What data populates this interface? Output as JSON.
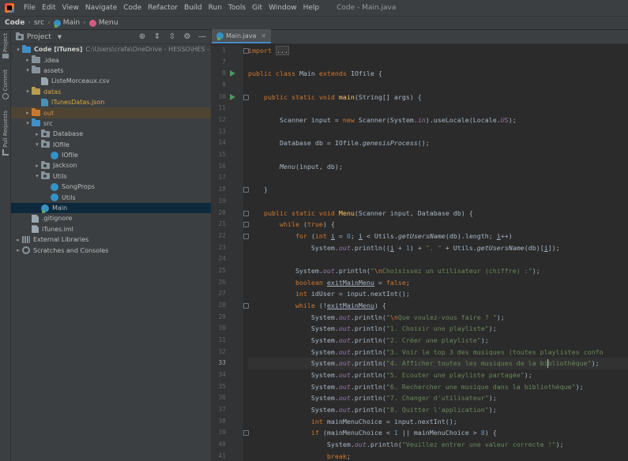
{
  "menubar": {
    "items": [
      "File",
      "Edit",
      "View",
      "Navigate",
      "Code",
      "Refactor",
      "Build",
      "Run",
      "Tools",
      "Git",
      "Window",
      "Help"
    ],
    "window_title": "Code - Main.java"
  },
  "breadcrumb": [
    "Code",
    "src",
    "Main",
    "Menu"
  ],
  "toolstrip": [
    "Project",
    "Commit",
    "Pull Requests"
  ],
  "project": {
    "title": "Project",
    "tree": [
      {
        "label": "Code [iTunes]",
        "path": "C:\\Users\\crafa\\OneDrive - HESSO\\HES - INFO G",
        "type": "folder-blue",
        "depth": 0,
        "arrow": "down"
      },
      {
        "label": ".idea",
        "type": "folder",
        "depth": 1,
        "arrow": "right"
      },
      {
        "label": "assets",
        "type": "folder",
        "depth": 1,
        "arrow": "down"
      },
      {
        "label": "ListeMorceaux.csv",
        "type": "file",
        "depth": 2,
        "arrow": "none"
      },
      {
        "label": "datas",
        "type": "folder-yellow",
        "depth": 1,
        "arrow": "down",
        "color": "yellow"
      },
      {
        "label": "iTunesDatas.json",
        "type": "file-json",
        "depth": 2,
        "arrow": "none",
        "color": "yellow"
      },
      {
        "label": "out",
        "type": "folder-orange",
        "depth": 1,
        "arrow": "right",
        "color": "orange",
        "excluded": true
      },
      {
        "label": "src",
        "type": "folder-blue",
        "depth": 1,
        "arrow": "down"
      },
      {
        "label": "Database",
        "type": "package",
        "depth": 2,
        "arrow": "right"
      },
      {
        "label": "IOfile",
        "type": "package",
        "depth": 2,
        "arrow": "down"
      },
      {
        "label": "IOfile",
        "type": "class",
        "depth": 3,
        "arrow": "none"
      },
      {
        "label": "Jackson",
        "type": "package",
        "depth": 2,
        "arrow": "right"
      },
      {
        "label": "Utils",
        "type": "package",
        "depth": 2,
        "arrow": "down"
      },
      {
        "label": "SongProps",
        "type": "class",
        "depth": 3,
        "arrow": "none"
      },
      {
        "label": "Utils",
        "type": "class",
        "depth": 3,
        "arrow": "none"
      },
      {
        "label": "Main",
        "type": "class-main",
        "depth": 2,
        "arrow": "none",
        "selected": true
      },
      {
        "label": ".gitignore",
        "type": "file",
        "depth": 1,
        "arrow": "none"
      },
      {
        "label": "iTunes.iml",
        "type": "file",
        "depth": 1,
        "arrow": "none"
      },
      {
        "label": "External Libraries",
        "type": "library",
        "depth": 0,
        "arrow": "right"
      },
      {
        "label": "Scratches and Consoles",
        "type": "scratch",
        "depth": 0,
        "arrow": "right"
      }
    ]
  },
  "editor": {
    "tab": "Main.java",
    "current_line": 33,
    "lines": [
      {
        "n": 1,
        "fold": true,
        "tokens": [
          {
            "t": "import ",
            "c": "kw"
          },
          {
            "t": "...",
            "c": "folded"
          }
        ]
      },
      {
        "n": 7,
        "tokens": []
      },
      {
        "n": 8,
        "run": true,
        "tokens": [
          {
            "t": "public class ",
            "c": "kw"
          },
          {
            "t": "Main ",
            "c": "plain"
          },
          {
            "t": "extends ",
            "c": "kw"
          },
          {
            "t": "IOfile {",
            "c": "plain"
          }
        ]
      },
      {
        "n": 9,
        "tokens": []
      },
      {
        "n": 10,
        "run": true,
        "fold": true,
        "tokens": [
          {
            "t": "    public static void ",
            "c": "kw"
          },
          {
            "t": "main",
            "c": "method"
          },
          {
            "t": "(String[] args) {",
            "c": "plain"
          }
        ]
      },
      {
        "n": 11,
        "tokens": []
      },
      {
        "n": 12,
        "tokens": [
          {
            "t": "        Scanner input = ",
            "c": "plain"
          },
          {
            "t": "new ",
            "c": "kw"
          },
          {
            "t": "Scanner(System.",
            "c": "plain"
          },
          {
            "t": "in",
            "c": "staticf"
          },
          {
            "t": ").useLocale(Locale.",
            "c": "plain"
          },
          {
            "t": "US",
            "c": "staticf"
          },
          {
            "t": ");",
            "c": "plain"
          }
        ]
      },
      {
        "n": 13,
        "tokens": []
      },
      {
        "n": 14,
        "tokens": [
          {
            "t": "        Database db = IOfile.",
            "c": "plain"
          },
          {
            "t": "genesisProcess",
            "c": "staticm"
          },
          {
            "t": "();",
            "c": "plain"
          }
        ]
      },
      {
        "n": 15,
        "tokens": []
      },
      {
        "n": 16,
        "tokens": [
          {
            "t": "        ",
            "c": "plain"
          },
          {
            "t": "Menu",
            "c": "staticm"
          },
          {
            "t": "(input, db);",
            "c": "plain"
          }
        ]
      },
      {
        "n": 17,
        "tokens": []
      },
      {
        "n": 18,
        "fold": true,
        "tokens": [
          {
            "t": "    }",
            "c": "plain"
          }
        ]
      },
      {
        "n": 19,
        "tokens": []
      },
      {
        "n": 20,
        "fold": true,
        "tokens": [
          {
            "t": "    public static void ",
            "c": "kw"
          },
          {
            "t": "Menu",
            "c": "method"
          },
          {
            "t": "(Scanner input, Database db) {",
            "c": "plain"
          }
        ]
      },
      {
        "n": 21,
        "fold": true,
        "tokens": [
          {
            "t": "        while ",
            "c": "kw"
          },
          {
            "t": "(",
            "c": "plain"
          },
          {
            "t": "true",
            "c": "kw"
          },
          {
            "t": ") {",
            "c": "plain"
          }
        ]
      },
      {
        "n": 22,
        "fold": true,
        "tokens": [
          {
            "t": "            for ",
            "c": "kw"
          },
          {
            "t": "(",
            "c": "plain"
          },
          {
            "t": "int ",
            "c": "kw"
          },
          {
            "t": "i",
            "c": "uvar"
          },
          {
            "t": " = ",
            "c": "plain"
          },
          {
            "t": "0",
            "c": "num"
          },
          {
            "t": "; ",
            "c": "plain"
          },
          {
            "t": "i",
            "c": "uvar"
          },
          {
            "t": " < Utils.",
            "c": "plain"
          },
          {
            "t": "getUsersName",
            "c": "staticm"
          },
          {
            "t": "(db).length; ",
            "c": "plain"
          },
          {
            "t": "i",
            "c": "uvar"
          },
          {
            "t": "++)",
            "c": "plain"
          }
        ]
      },
      {
        "n": 23,
        "tokens": [
          {
            "t": "                System.",
            "c": "plain"
          },
          {
            "t": "out",
            "c": "staticf"
          },
          {
            "t": ".println((",
            "c": "plain"
          },
          {
            "t": "i",
            "c": "uvar"
          },
          {
            "t": " + ",
            "c": "plain"
          },
          {
            "t": "1",
            "c": "num"
          },
          {
            "t": ") + ",
            "c": "plain"
          },
          {
            "t": "\". \"",
            "c": "str"
          },
          {
            "t": " + Utils.",
            "c": "plain"
          },
          {
            "t": "getUsersName",
            "c": "staticm"
          },
          {
            "t": "(db)[",
            "c": "plain"
          },
          {
            "t": "i",
            "c": "uvar"
          },
          {
            "t": "]);",
            "c": "plain"
          }
        ]
      },
      {
        "n": 24,
        "tokens": []
      },
      {
        "n": 25,
        "tokens": [
          {
            "t": "            System.",
            "c": "plain"
          },
          {
            "t": "out",
            "c": "staticf"
          },
          {
            "t": ".println(",
            "c": "plain"
          },
          {
            "t": "\"",
            "c": "str"
          },
          {
            "t": "\\n",
            "c": "esc"
          },
          {
            "t": "Choisissez un utilisateur (chiffre) :\"",
            "c": "str"
          },
          {
            "t": ");",
            "c": "plain"
          }
        ]
      },
      {
        "n": 26,
        "tokens": [
          {
            "t": "            boolean ",
            "c": "kw"
          },
          {
            "t": "exitMainMenu",
            "c": "uvar"
          },
          {
            "t": " = ",
            "c": "plain"
          },
          {
            "t": "false",
            "c": "kw"
          },
          {
            "t": ";",
            "c": "plain"
          }
        ]
      },
      {
        "n": 27,
        "tokens": [
          {
            "t": "            int ",
            "c": "kw"
          },
          {
            "t": "idUser = input.nextInt();",
            "c": "plain"
          }
        ]
      },
      {
        "n": 28,
        "fold": true,
        "tokens": [
          {
            "t": "            while ",
            "c": "kw"
          },
          {
            "t": "(!",
            "c": "plain"
          },
          {
            "t": "exitMainMenu",
            "c": "uvar"
          },
          {
            "t": ") {",
            "c": "plain"
          }
        ]
      },
      {
        "n": 29,
        "tokens": [
          {
            "t": "                System.",
            "c": "plain"
          },
          {
            "t": "out",
            "c": "staticf"
          },
          {
            "t": ".println(",
            "c": "plain"
          },
          {
            "t": "\"",
            "c": "str"
          },
          {
            "t": "\\n",
            "c": "esc"
          },
          {
            "t": "Que voulez-vous faire ? \"",
            "c": "str"
          },
          {
            "t": ");",
            "c": "plain"
          }
        ]
      },
      {
        "n": 30,
        "tokens": [
          {
            "t": "                System.",
            "c": "plain"
          },
          {
            "t": "out",
            "c": "staticf"
          },
          {
            "t": ".println(",
            "c": "plain"
          },
          {
            "t": "\"1. Choisir une playliste\"",
            "c": "str"
          },
          {
            "t": ");",
            "c": "plain"
          }
        ]
      },
      {
        "n": 31,
        "tokens": [
          {
            "t": "                System.",
            "c": "plain"
          },
          {
            "t": "out",
            "c": "staticf"
          },
          {
            "t": ".println(",
            "c": "plain"
          },
          {
            "t": "\"2. Créer une playliste\"",
            "c": "str"
          },
          {
            "t": ");",
            "c": "plain"
          }
        ]
      },
      {
        "n": 32,
        "tokens": [
          {
            "t": "                System.",
            "c": "plain"
          },
          {
            "t": "out",
            "c": "staticf"
          },
          {
            "t": ".println(",
            "c": "plain"
          },
          {
            "t": "\"3. Voir le top 3 des musiques (toutes playlistes confo",
            "c": "str"
          }
        ]
      },
      {
        "n": 33,
        "tokens": [
          {
            "t": "                System.",
            "c": "plain"
          },
          {
            "t": "out",
            "c": "staticf"
          },
          {
            "t": ".println(",
            "c": "plain"
          },
          {
            "t": "\"4. Afficher toutes les musiques de la bi",
            "c": "str"
          },
          {
            "t": "|",
            "c": "caret"
          },
          {
            "t": "bliothèque\"",
            "c": "str"
          },
          {
            "t": ");",
            "c": "plain"
          }
        ]
      },
      {
        "n": 34,
        "tokens": [
          {
            "t": "                System.",
            "c": "plain"
          },
          {
            "t": "out",
            "c": "staticf"
          },
          {
            "t": ".println(",
            "c": "plain"
          },
          {
            "t": "\"5. Ecouter une playliste partagée\"",
            "c": "str"
          },
          {
            "t": ");",
            "c": "plain"
          }
        ]
      },
      {
        "n": 35,
        "tokens": [
          {
            "t": "                System.",
            "c": "plain"
          },
          {
            "t": "out",
            "c": "staticf"
          },
          {
            "t": ".println(",
            "c": "plain"
          },
          {
            "t": "\"6. Rechercher une musique dans la bibliothèque\"",
            "c": "str"
          },
          {
            "t": ");",
            "c": "plain"
          }
        ]
      },
      {
        "n": 36,
        "tokens": [
          {
            "t": "                System.",
            "c": "plain"
          },
          {
            "t": "out",
            "c": "staticf"
          },
          {
            "t": ".println(",
            "c": "plain"
          },
          {
            "t": "\"7. Changer d'utilisateur\"",
            "c": "str"
          },
          {
            "t": ");",
            "c": "plain"
          }
        ]
      },
      {
        "n": 37,
        "tokens": [
          {
            "t": "                System.",
            "c": "plain"
          },
          {
            "t": "out",
            "c": "staticf"
          },
          {
            "t": ".println(",
            "c": "plain"
          },
          {
            "t": "\"8. Quitter l'application\"",
            "c": "str"
          },
          {
            "t": ");",
            "c": "plain"
          }
        ]
      },
      {
        "n": 38,
        "tokens": [
          {
            "t": "                int ",
            "c": "kw"
          },
          {
            "t": "mainMenuChoice = input.nextInt();",
            "c": "plain"
          }
        ]
      },
      {
        "n": 39,
        "fold": true,
        "tokens": [
          {
            "t": "                if ",
            "c": "kw"
          },
          {
            "t": "(mainMenuChoice < ",
            "c": "plain"
          },
          {
            "t": "1",
            "c": "num"
          },
          {
            "t": " || mainMenuChoice > ",
            "c": "plain"
          },
          {
            "t": "8",
            "c": "num"
          },
          {
            "t": ") {",
            "c": "plain"
          }
        ]
      },
      {
        "n": 40,
        "tokens": [
          {
            "t": "                    System.",
            "c": "plain"
          },
          {
            "t": "out",
            "c": "staticf"
          },
          {
            "t": ".println(",
            "c": "plain"
          },
          {
            "t": "\"Veuillez entrer une valeur correcte !\"",
            "c": "str"
          },
          {
            "t": ");",
            "c": "plain"
          }
        ]
      },
      {
        "n": 41,
        "tokens": [
          {
            "t": "                    break",
            "c": "kw"
          },
          {
            "t": ";",
            "c": "plain"
          }
        ]
      }
    ]
  },
  "colors": {
    "kw": "#cc7832",
    "plain": "#a9b7c6",
    "method": "#ffc66d",
    "staticf": "#9876aa",
    "staticm": "#a9b7c6",
    "str": "#6a8759",
    "esc": "#cc7832",
    "num": "#6897bb",
    "uvar": "#a9b7c6",
    "folded": "#a9b7c6"
  }
}
